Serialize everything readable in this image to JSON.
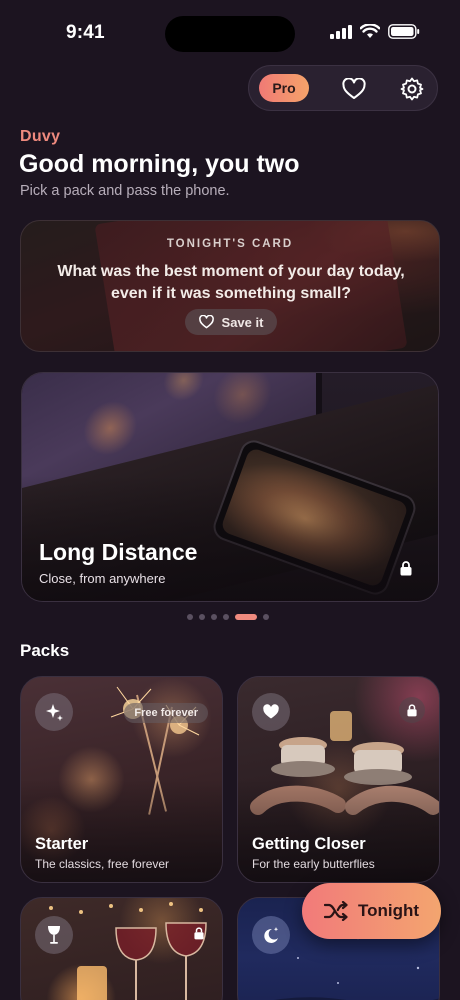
{
  "status_bar": {
    "time": "9:41"
  },
  "header": {
    "pro_label": "Pro"
  },
  "greeting": {
    "brand": "Duvy",
    "title": "Good morning, you two",
    "subtitle": "Pick a pack and pass the phone."
  },
  "tonight_card": {
    "eyebrow": "TONIGHT'S CARD",
    "question": "What was the best moment of your day today, even if it was something small?",
    "save_label": "Save it"
  },
  "featured": {
    "title": "Long Distance",
    "subtitle": "Close, from anywhere",
    "locked": true,
    "carousel_count": 6,
    "carousel_active_index": 4
  },
  "packs": {
    "heading": "Packs",
    "items": [
      {
        "name": "Starter",
        "desc": "The classics, free forever",
        "badge": "Free forever",
        "icon": "sparkle-icon",
        "locked": false
      },
      {
        "name": "Getting Closer",
        "desc": "For the early butterflies",
        "icon": "heart-icon",
        "locked": true
      },
      {
        "name": "",
        "desc": "",
        "icon": "wine-glass-icon",
        "locked": true
      },
      {
        "name": "",
        "desc": "",
        "icon": "moon-stars-icon",
        "locked": false
      }
    ]
  },
  "fab": {
    "label": "Tonight",
    "icon": "shuffle-icon"
  },
  "colors": {
    "accent": "#ef8a7e",
    "background": "#1c1420",
    "fab_start": "#f27a7a",
    "fab_end": "#f3a56f"
  }
}
